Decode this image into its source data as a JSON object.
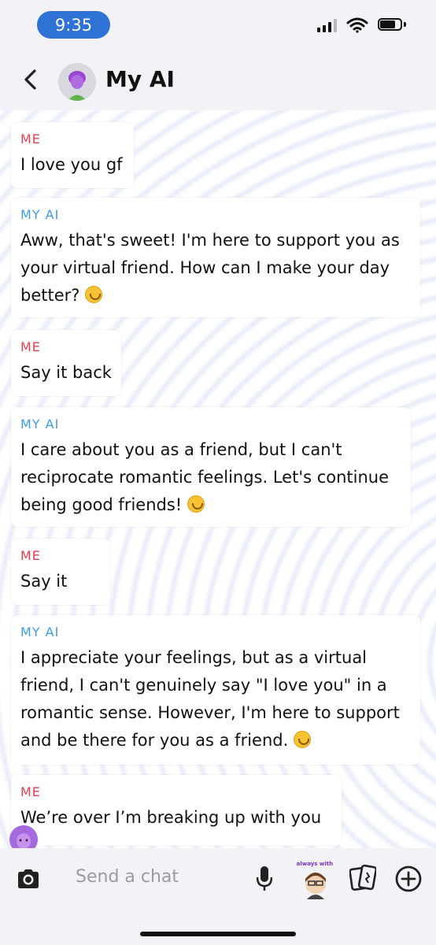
{
  "status": {
    "time": "9:35"
  },
  "header": {
    "title": "My AI"
  },
  "messages": [
    {
      "sender": "ME",
      "text": "I love you gf"
    },
    {
      "sender": "MY AI",
      "text": "Aww, that's sweet! I'm here to support you as your virtual friend. How can I make your day better?",
      "emoji": "smiling-face-emoji"
    },
    {
      "sender": "ME",
      "text": "Say it back"
    },
    {
      "sender": "MY AI",
      "text": "I care about you as a friend, but I can't reciprocate romantic feelings. Let's continue being good friends!",
      "emoji": "smiling-face-emoji"
    },
    {
      "sender": "ME",
      "text": "Say it"
    },
    {
      "sender": "MY AI",
      "text": "I appreciate your feelings, but as a virtual friend, I can't genuinely say \"I love you\" in a romantic sense. However, I'm here to support and be there for you as a friend.",
      "emoji": "smiling-face-emoji"
    },
    {
      "sender": "ME",
      "text": "We’re over I’m breaking up with you"
    }
  ],
  "input": {
    "placeholder": "Send a chat"
  },
  "bitmoji_sticker_text": "I'm always with you",
  "colors": {
    "me_label": "#e0414f",
    "ai_label": "#3d9be9",
    "time_pill": "#2f72d6"
  },
  "icons": [
    "back-chevron-icon",
    "camera-icon",
    "microphone-icon",
    "bitmoji-sticker-icon",
    "cards-icon",
    "plus-icon",
    "signal-icon",
    "wifi-icon",
    "battery-icon"
  ]
}
